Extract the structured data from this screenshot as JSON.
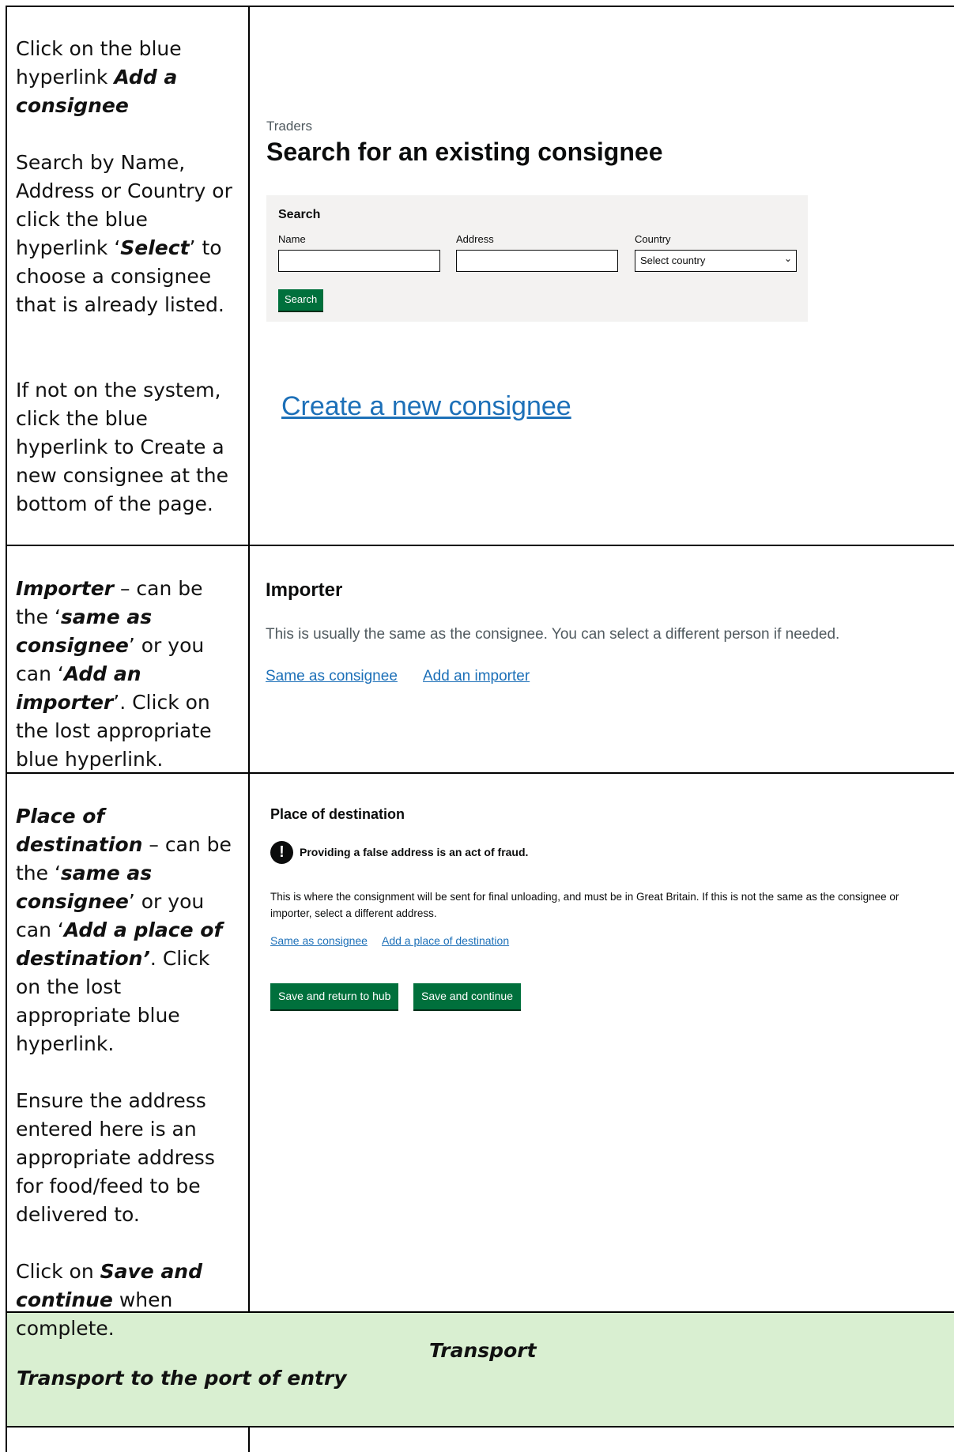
{
  "row1": {
    "instructions": {
      "p1_prefix": "Click on the blue hyperlink ",
      "p1_bold": "Add a consignee",
      "p2_prefix": "Search by Name, Address or Country or click the blue hyperlink ‘",
      "p2_bold": "Select",
      "p2_suffix": "’ to choose a consignee that is already listed.",
      "p3": "If not on the system, click the blue hyperlink to Create a new consignee at the bottom of the page."
    },
    "screenshot": {
      "caption": "Traders",
      "heading": "Search for an existing consignee",
      "panel_title": "Search",
      "name_label": "Name",
      "address_label": "Address",
      "country_label": "Country",
      "country_selected": "Select country",
      "search_button": "Search",
      "create_link": "Create a new consignee"
    }
  },
  "row2": {
    "instructions": {
      "lead_bold": "Importer",
      "t1": " – can be the ‘",
      "b1": "same as consignee",
      "t2": "’ or you can ‘",
      "b2": "Add an importer",
      "t3": "’. Click on the lost appropriate blue hyperlink."
    },
    "screenshot": {
      "heading": "Importer",
      "description": "This is usually the same as the consignee. You can select a different person if needed.",
      "link_same": "Same as consignee",
      "link_add": "Add an importer"
    }
  },
  "row3": {
    "instructions": {
      "lead_bold": "Place of destination",
      "t1": " – can be the ‘",
      "b1": "same as consignee",
      "t2": "’ or you can ‘",
      "b2": "Add a place of destination’",
      "t3": ". Click on the lost appropriate blue hyperlink.",
      "p2": "Ensure the address entered here is an appropriate address for food/feed to be delivered to.",
      "p3_prefix": "Click on ",
      "p3_bold": "Save and continue",
      "p3_suffix": " when complete."
    },
    "screenshot": {
      "heading": "Place of destination",
      "warning_icon": "!",
      "warning_text": "Providing a false address is an act of fraud.",
      "description": "This is where the consignment will be sent for final unloading, and must be in Great Britain. If this is not the same as the consignee or importer, select a different address.",
      "link_same": "Same as consignee",
      "link_add": "Add a place of destination",
      "btn_save_return": "Save and return to hub",
      "btn_save_continue": "Save and continue"
    }
  },
  "transport": {
    "title": "Transport",
    "subtitle": "Transport to the port of entry",
    "band_color": "#d9efd1"
  },
  "colors": {
    "link_blue": "#1d70b8",
    "button_green": "#00703c",
    "panel_grey": "#f3f2f1"
  }
}
